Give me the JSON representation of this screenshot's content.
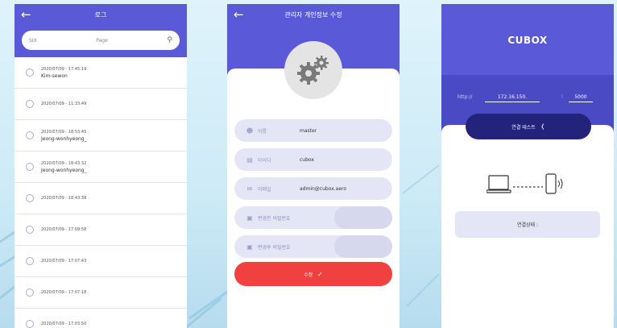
{
  "log_screen": {
    "title": "로그",
    "search_prefix": "SIX",
    "search_placeholder": "Page",
    "items": [
      {
        "datetime": "2020/07/09 - 17:45:19",
        "name": "Kim-sewon"
      },
      {
        "datetime": "2020/07/09 - 11:33:49",
        "name": ""
      },
      {
        "datetime": "2020/07/09 - 18:53:45",
        "name": "Jeong-wonhyeong_"
      },
      {
        "datetime": "2020/07/09 - 18:43:32",
        "name": "Jeong-wonhyeong_"
      },
      {
        "datetime": "2020/07/09 - 18:43:38",
        "name": ""
      },
      {
        "datetime": "2020/07/09 - 17:09:58",
        "name": ""
      },
      {
        "datetime": "2020/07/09 - 17:07:43",
        "name": ""
      },
      {
        "datetime": "2020/07/09 - 17:07:18",
        "name": ""
      },
      {
        "datetime": "2020/07/09 - 17:03:50",
        "name": ""
      }
    ]
  },
  "edit_screen": {
    "title": "관리자 개인정보 수정",
    "fields": [
      {
        "icon": "user-icon",
        "label": "이름",
        "value": "master"
      },
      {
        "icon": "id-card-icon",
        "label": "아이디",
        "value": "cubox"
      },
      {
        "icon": "mail-icon",
        "label": "이메일",
        "value": "admin@cubox.aero"
      },
      {
        "icon": "lock-icon",
        "label": "변경전 비밀번호",
        "value": ""
      },
      {
        "icon": "lock-icon",
        "label": "변경후 비밀번호",
        "value": ""
      }
    ],
    "submit_label": "수정"
  },
  "cubox_screen": {
    "logo": "CUBOX",
    "url_prefix": "http://",
    "ip": "172.16.150.",
    "colon": ":",
    "port": "5000",
    "connect_button": "연결 테스트",
    "status_label": "연결상태 :"
  },
  "colors": {
    "header_purple": "#5a5ad8",
    "dark_navy": "#23237c",
    "submit_red": "#f04040",
    "field_bg": "#e4e6f6"
  }
}
